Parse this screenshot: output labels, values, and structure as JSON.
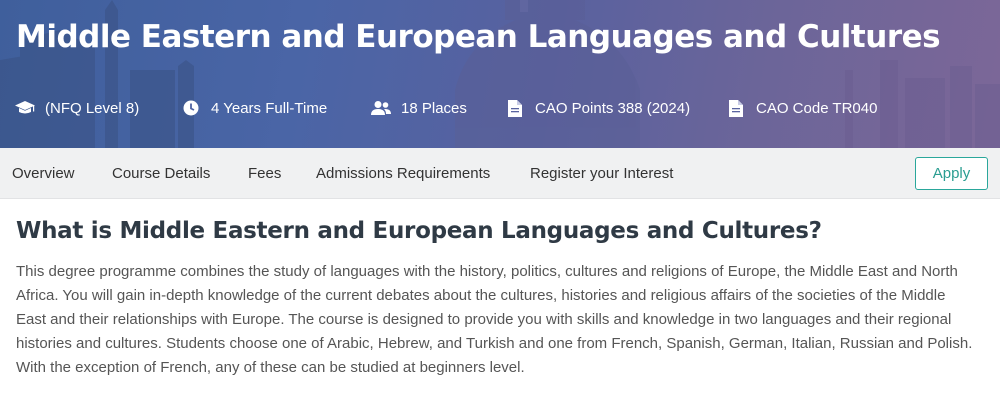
{
  "hero": {
    "title": "Middle Eastern and European Languages and Cultures",
    "facts": [
      {
        "icon": "graduation-cap-icon",
        "text": "(NFQ Level 8)"
      },
      {
        "icon": "clock-icon",
        "text": "4 Years Full-Time"
      },
      {
        "icon": "users-icon",
        "text": "18 Places"
      },
      {
        "icon": "document-icon",
        "text": "CAO Points 388 (2024)"
      },
      {
        "icon": "document-icon",
        "text": "CAO Code TR040"
      }
    ]
  },
  "tabs": [
    "Overview",
    "Course Details",
    "Fees",
    "Admissions Requirements",
    "Register your Interest"
  ],
  "apply_label": "Apply",
  "content": {
    "heading": "What is Middle Eastern and European Languages and Cultures?",
    "body": "This degree programme combines the study of languages with the history, politics, cultures and religions of Europe, the Middle East and North Africa. You will gain in-depth knowledge of the current debates about the cultures, histories and religious affairs of the societies of the Middle East and their relationships with Europe. The course is designed to provide you with skills and knowledge in two languages and their regional histories and cultures. Students choose one of Arabic, Hebrew, and Turkish and one from French, Spanish, German, Italian, Russian and Polish. With the exception of French, any of these can be studied at beginners level."
  },
  "colors": {
    "accent": "#2aa79b",
    "hero_start": "#3f5f9c",
    "hero_end": "#7c6798",
    "tabbar_bg": "#f0f1f2",
    "heading": "#2f3a45"
  }
}
